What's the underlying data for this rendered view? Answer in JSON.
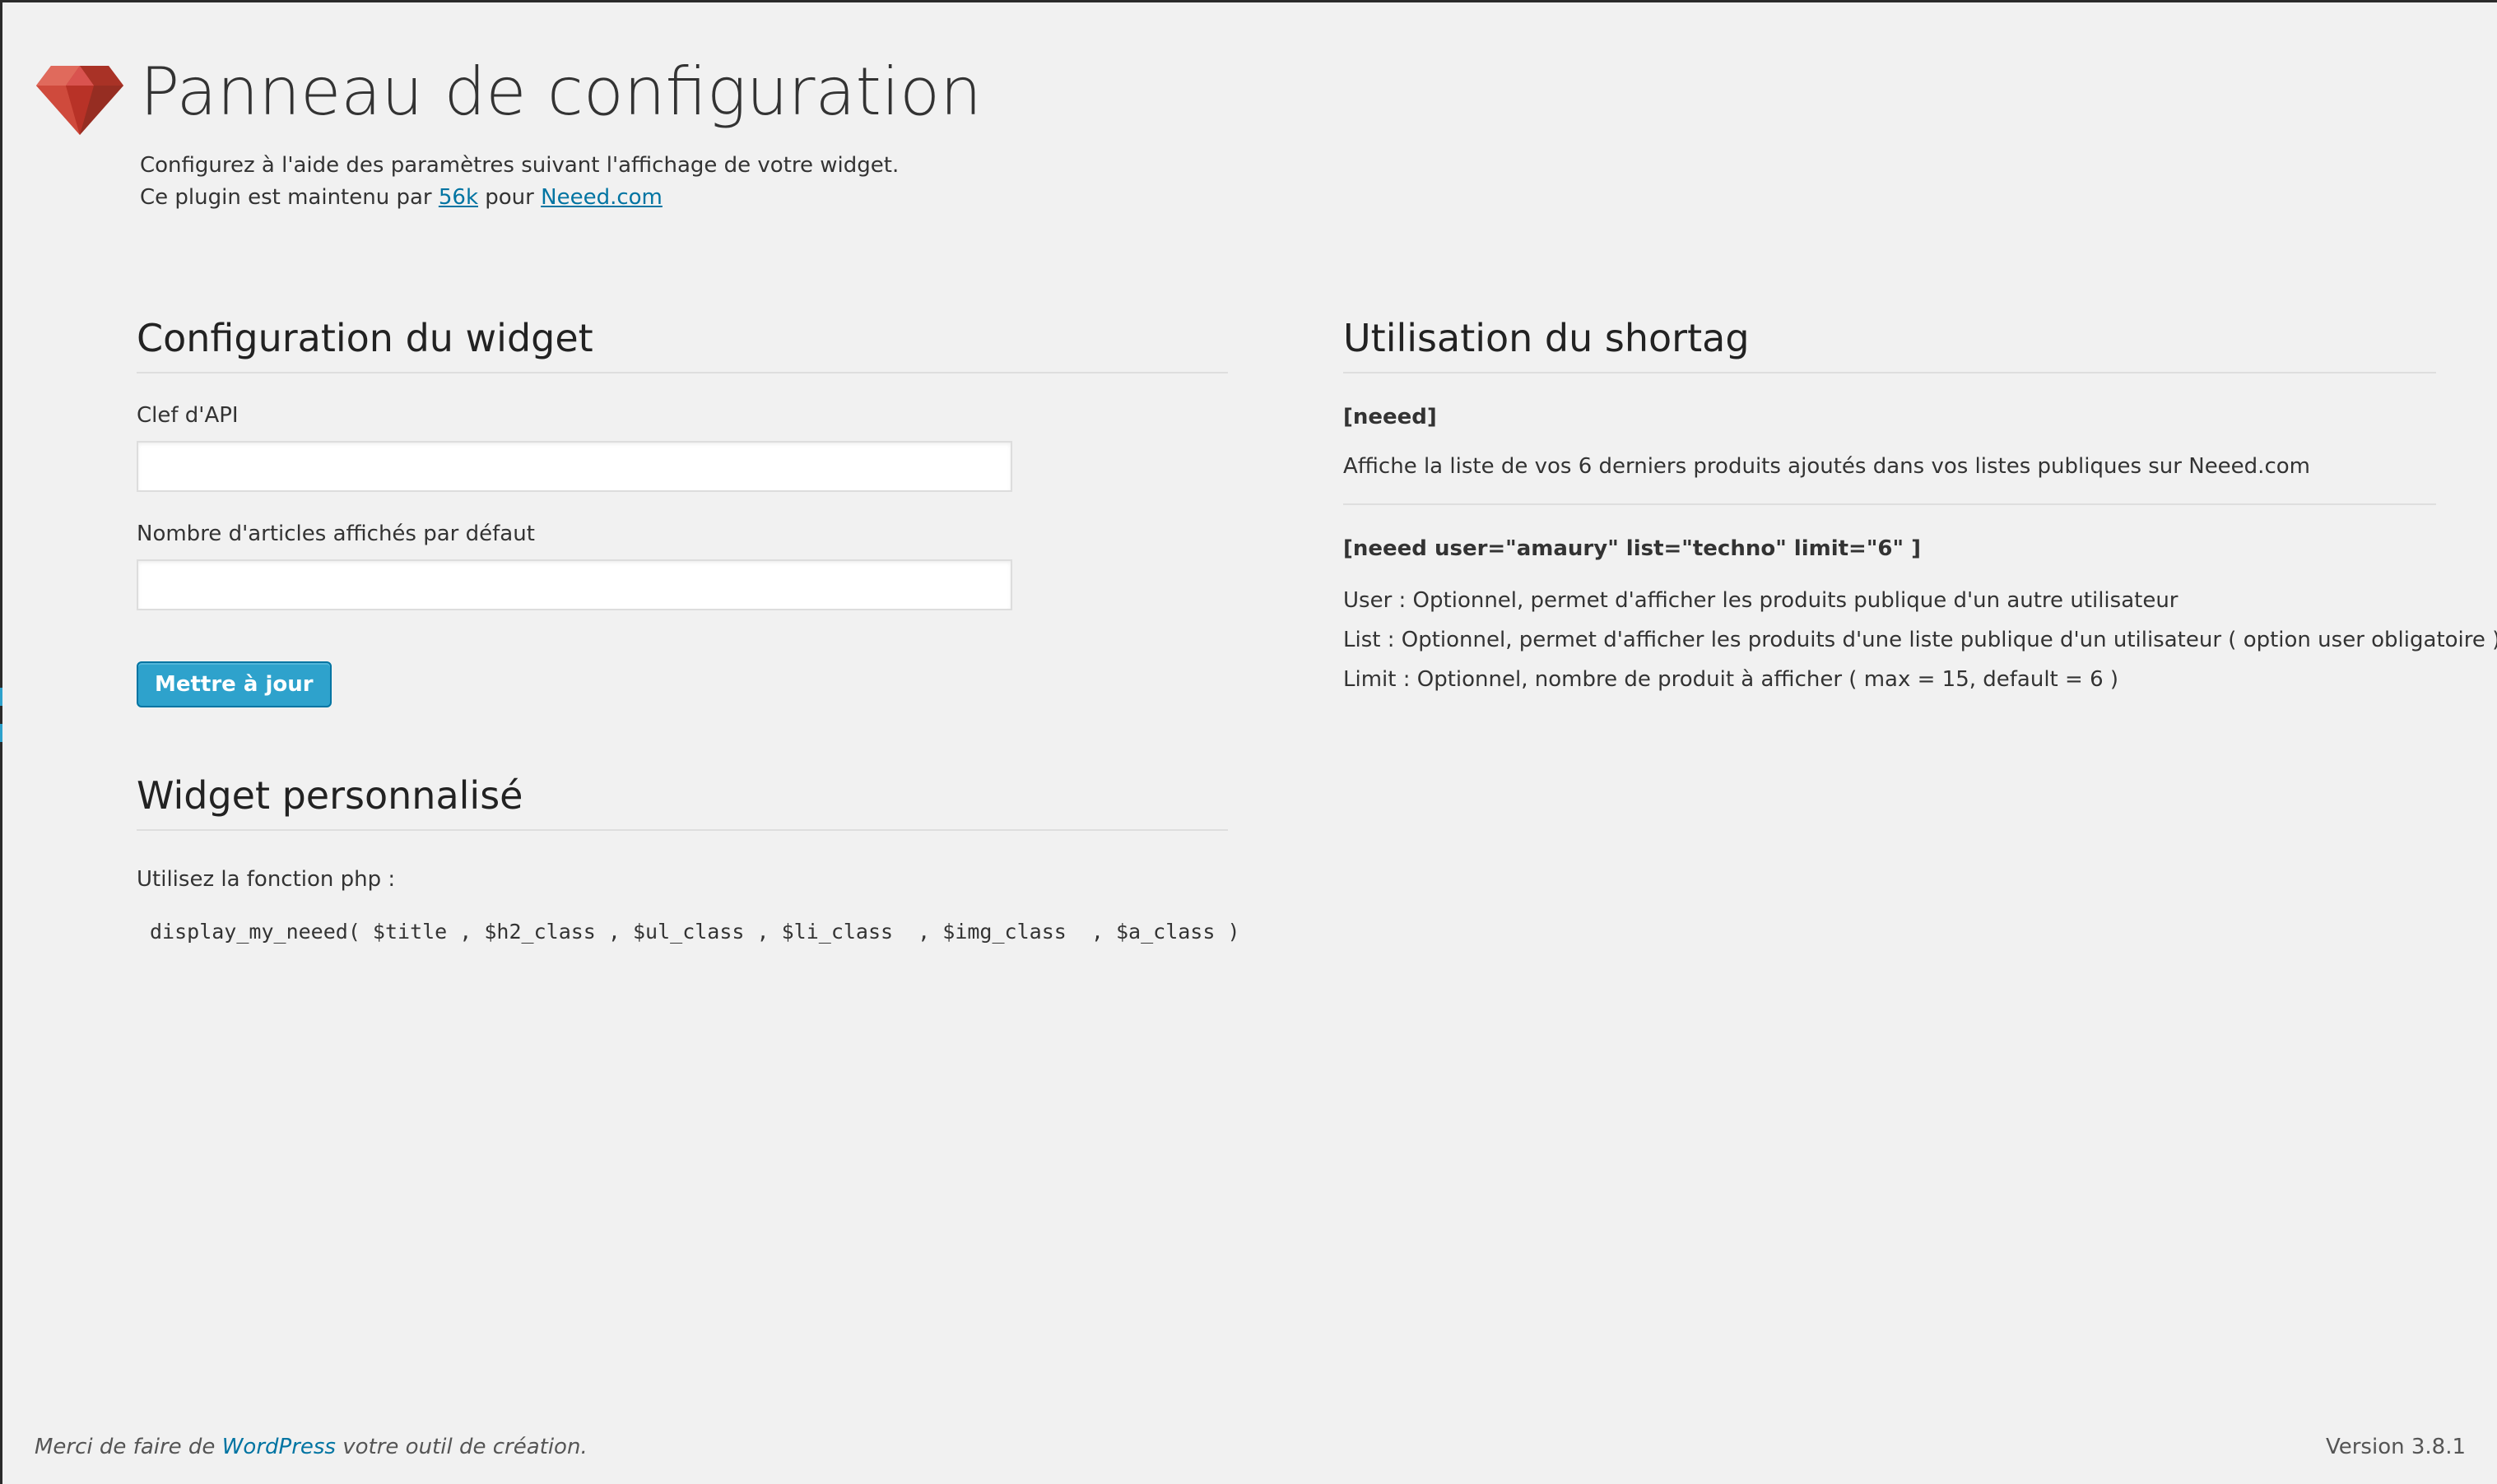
{
  "header": {
    "title": "Panneau de configuration",
    "intro_line1": "Configurez à l'aide des paramètres suivant l'affichage de votre widget.",
    "intro_line2_prefix": "Ce plugin est maintenu par",
    "intro_link1": "56k",
    "intro_line2_mid": "pour",
    "intro_link2": "Neeed.com",
    "logo_icon": "ruby-gem-icon"
  },
  "widget_config": {
    "title": "Configuration du widget",
    "api_key_label": "Clef d'API",
    "api_key_value": "",
    "count_label": "Nombre d'articles affichés par défaut",
    "count_value": "",
    "submit_label": "Mettre à jour"
  },
  "custom_widget": {
    "title": "Widget personnalisé",
    "php_intro": "Utilisez la fonction php :",
    "php_code": "display_my_neeed( $title , $h2_class , $ul_class , $li_class  , $img_class  , $a_class )"
  },
  "shortcode": {
    "title": "Utilisation du shortag",
    "basic_tag": "[neeed]",
    "basic_desc": "Affiche la liste de vos 6 derniers produits ajoutés dans vos listes publiques sur Neeed.com",
    "advanced_tag": "[neeed user=\"amaury\" list=\"techno\" limit=\"6\" ]",
    "params": [
      "User : Optionnel, permet d'afficher les produits publique d'un autre utilisateur",
      "List : Optionnel, permet d'afficher les produits d'une liste publique d'un utilisateur ( option user obligatoire )",
      "Limit : Optionnel, nombre de produit à afficher ( max = 15, default = 6 )"
    ]
  },
  "footer": {
    "thanks_prefix": "Merci de faire de",
    "thanks_link": "WordPress",
    "thanks_suffix": "votre outil de création.",
    "version": "Version 3.8.1"
  },
  "colors": {
    "background": "#f1f1f1",
    "accent": "#2ea2cc",
    "link": "#0074a2",
    "logo": "#c0392b"
  }
}
